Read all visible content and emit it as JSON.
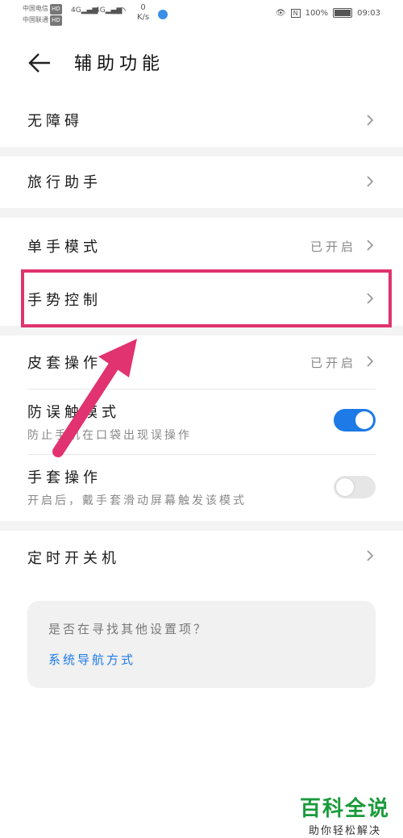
{
  "status_bar": {
    "carrier1": "中国电信",
    "carrier2": "中国联通",
    "hd": "HD",
    "net": "4G",
    "speed_value": "0",
    "speed_unit": "K/s",
    "battery": "100%",
    "time": "09:03"
  },
  "header": {
    "title": "辅助功能"
  },
  "items": [
    {
      "label": "无障碍"
    },
    {
      "label": "旅行助手"
    },
    {
      "label": "单手模式",
      "status": "已开启"
    },
    {
      "label": "手势控制"
    },
    {
      "label": "皮套操作",
      "status": "已开启"
    },
    {
      "label": "防误触模式",
      "sub": "防止手机在口袋出现误操作",
      "toggle": true
    },
    {
      "label": "手套操作",
      "sub": "开启后，戴手套滑动屏幕触发该模式",
      "toggle": false
    },
    {
      "label": "定时开关机"
    }
  ],
  "suggest": {
    "question": "是否在寻找其他设置项？",
    "link": "系统导航方式"
  },
  "watermark": {
    "brand": "百科全说",
    "slogan": "助你轻松解决"
  },
  "colors": {
    "accent": "#1e7ae6",
    "highlight": "#e0336f",
    "watermark": "#1a9a3a"
  }
}
